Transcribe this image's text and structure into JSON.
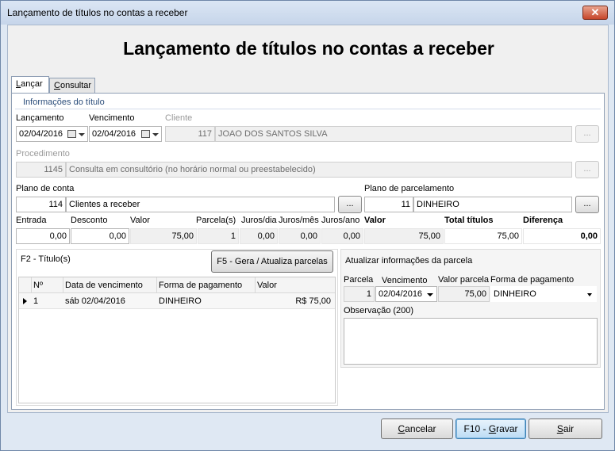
{
  "window": {
    "title": "Lançamento de títulos no contas a receber",
    "close": "✕"
  },
  "header": {
    "title": "Lançamento de títulos no contas a receber"
  },
  "tabs": [
    {
      "label": "Lançar",
      "hotkey": "L",
      "rest": "ançar"
    },
    {
      "label": "Consultar",
      "hotkey": "C",
      "rest": "onsultar"
    }
  ],
  "info": {
    "section": "Informações do título",
    "lancamento_label": "Lançamento",
    "lancamento_value": "02/04/2016",
    "vencimento_label": "Vencimento",
    "vencimento_value": "02/04/2016",
    "cliente_label": "Cliente",
    "cliente_code": "117",
    "cliente_name": "JOAO DOS SANTOS SILVA",
    "procedimento_label": "Procedimento",
    "procedimento_code": "1145",
    "procedimento_name": "Consulta em consultório (no horário normal ou preestabelecido)",
    "plano_conta_label": "Plano de conta",
    "plano_conta_code": "114",
    "plano_conta_name": "Clientes a receber",
    "plano_parc_label": "Plano de parcelamento",
    "plano_parc_code": "11",
    "plano_parc_name": "DINHEIRO",
    "ellipsis": "..."
  },
  "totals": {
    "entrada_label": "Entrada",
    "entrada": "0,00",
    "desconto_label": "Desconto",
    "desconto": "0,00",
    "valor_label": "Valor",
    "valor": "75,00",
    "parcelas_label": "Parcela(s)",
    "parcelas": "1",
    "juros_dia_label": "Juros/dia",
    "juros_dia": "0,00",
    "juros_mes_label": "Juros/mês",
    "juros_mes": "0,00",
    "juros_ano_label": "Juros/ano",
    "juros_ano": "0,00",
    "valor2_label": "Valor",
    "valor2": "75,00",
    "total_label": "Total títulos",
    "total": "75,00",
    "diferenca_label": "Diferença",
    "diferenca": "0,00"
  },
  "titulos": {
    "label": "F2 - Título(s)",
    "gera_button": "F5 - Gera / Atualiza parcelas",
    "columns": [
      "Nº",
      "Data de vencimento",
      "Forma de pagamento",
      "Valor"
    ],
    "rows": [
      {
        "n": "1",
        "data": "sáb 02/04/2016",
        "forma": "DINHEIRO",
        "valor": "R$ 75,00"
      }
    ]
  },
  "parcela": {
    "title": "Atualizar informações da parcela",
    "parcela_label": "Parcela",
    "parcela": "1",
    "vencimento_label": "Vencimento",
    "vencimento": "02/04/2016",
    "valor_label": "Valor parcela",
    "valor": "75,00",
    "forma_label": "Forma de pagamento",
    "forma": "DINHEIRO",
    "obs_label": "Observação (200)"
  },
  "footer": {
    "cancelar": {
      "hotkey": "C",
      "rest": "ancelar"
    },
    "gravar": {
      "prefix": "F10 - ",
      "hotkey": "G",
      "rest": "ravar"
    },
    "sair": {
      "hotkey": "S",
      "rest": "air"
    }
  }
}
